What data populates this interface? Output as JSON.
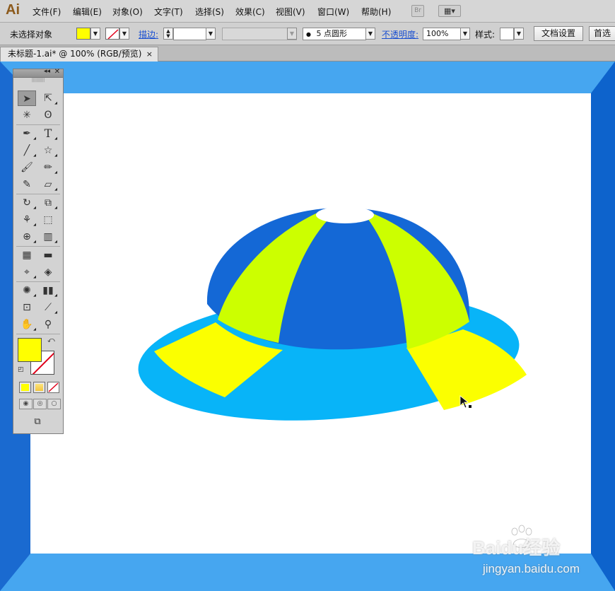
{
  "app": {
    "logo": "Ai"
  },
  "menu": {
    "items": [
      "文件(F)",
      "编辑(E)",
      "对象(O)",
      "文字(T)",
      "选择(S)",
      "效果(C)",
      "视图(V)",
      "窗口(W)",
      "帮助(H)"
    ],
    "bridge_label": "Br",
    "arrange_icon": "workspace-arrange-icon"
  },
  "control_bar": {
    "selection_status": "未选择对象",
    "fill_color": "#ffff00",
    "stroke_label": "描边:",
    "brush_value": "5 点圆形",
    "opacity_label": "不透明度:",
    "opacity_value": "100%",
    "style_label": "样式:",
    "document_setup_button": "文档设置",
    "preferences_button": "首选"
  },
  "document": {
    "tab_title": "未标题-1.ai* @ 100% (RGB/预览)",
    "close_symbol": "×"
  },
  "tools_panel": {
    "collapse_symbol": "◂◂",
    "close_symbol": "✕",
    "fill_color": "#ffff00",
    "stroke_color": "none"
  },
  "canvas": {
    "background_frame_color": "#1a75d9",
    "artboard_color": "#ffffff",
    "artwork": {
      "dome_blue": "#1468d6",
      "stripe_yellow_green": "#ccff00",
      "brim_cyan": "#08b4f8",
      "brim_yellow": "#fbff00",
      "top_oval": "#ffffff"
    }
  },
  "watermark": {
    "logo": "Baidu经验",
    "url": "jingyan.baidu.com"
  }
}
